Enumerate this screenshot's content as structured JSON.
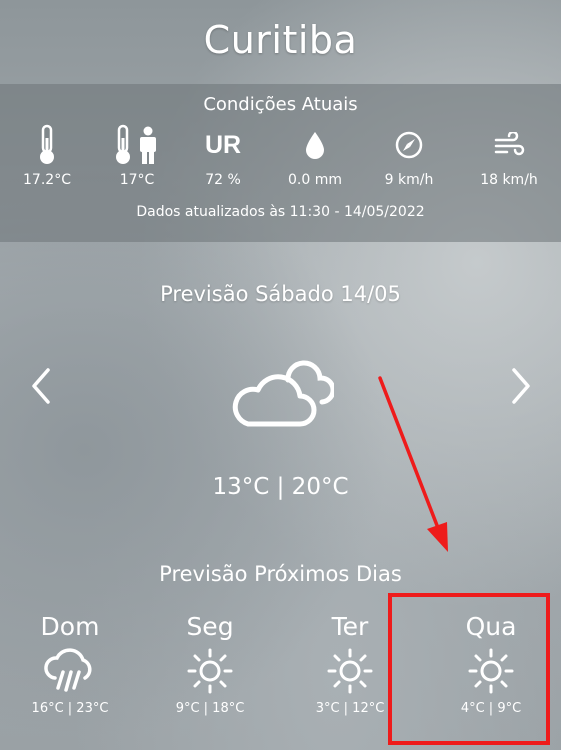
{
  "city": "Curitiba",
  "current": {
    "title": "Condições Atuais",
    "items": [
      {
        "icon": "thermometer-icon",
        "value": "17.2°C"
      },
      {
        "icon": "feels-like-icon",
        "value": "17°C"
      },
      {
        "icon": "humidity-label",
        "label": "UR",
        "value": "72 %"
      },
      {
        "icon": "rain-drop-icon",
        "value": "0.0 mm"
      },
      {
        "icon": "wind-gauge-icon",
        "value": "9 km/h"
      },
      {
        "icon": "wind-gust-icon",
        "value": "18 km/h"
      }
    ],
    "updated": "Dados atualizados às 11:30 - 14/05/2022"
  },
  "forecast": {
    "title": "Previsão Sábado 14/05",
    "icon": "cloudy-icon",
    "temps": "13°C | 20°C"
  },
  "next_days": {
    "title": "Previsão Próximos Dias",
    "days": [
      {
        "name": "Dom",
        "icon": "rain-icon",
        "range": "16°C | 23°C"
      },
      {
        "name": "Seg",
        "icon": "sun-icon",
        "range": "9°C | 18°C"
      },
      {
        "name": "Ter",
        "icon": "sun-icon",
        "range": "3°C | 12°C"
      },
      {
        "name": "Qua",
        "icon": "sun-icon",
        "range": "4°C | 9°C"
      }
    ]
  },
  "colors": {
    "highlight": "#ee1b1b"
  }
}
